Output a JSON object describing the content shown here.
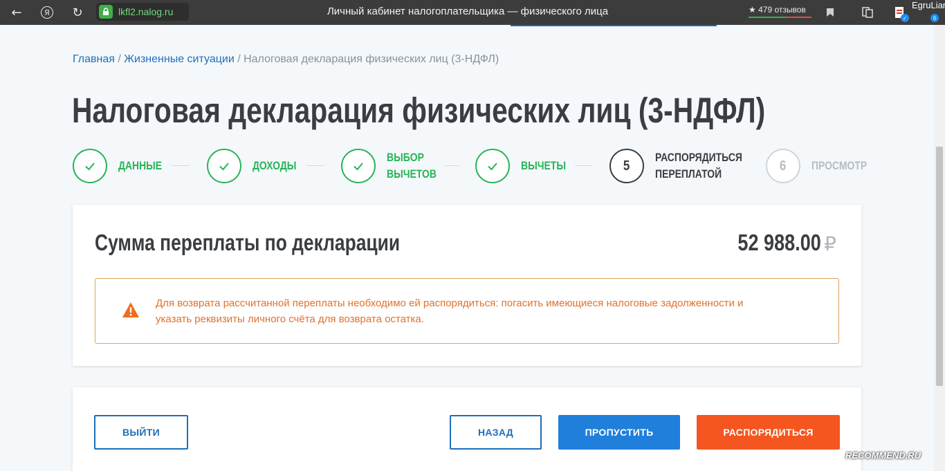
{
  "browser": {
    "url": "lkfl2.nalog.ru",
    "title": "Личный кабинет налогоплательщика — физического лица",
    "reviews": "479 отзывов",
    "reviews_star": "★",
    "user": "EgruLian",
    "badge_count": "6",
    "back_glyph": "←",
    "yandex_glyph": "Я",
    "reload_glyph": "↻"
  },
  "breadcrumb": {
    "home": "Главная",
    "sep1": " / ",
    "situations": "Жизненные ситуации",
    "sep2": " / ",
    "current": "Налоговая декларация физических лиц (3-НДФЛ)"
  },
  "page": {
    "title": "Налоговая декларация физических лиц (3-НДФЛ)"
  },
  "steps": [
    {
      "label_line1": "ДАННЫЕ",
      "label_line2": "",
      "state": "done",
      "num": ""
    },
    {
      "label_line1": "ДОХОДЫ",
      "label_line2": "",
      "state": "done",
      "num": ""
    },
    {
      "label_line1": "ВЫБОР",
      "label_line2": "ВЫЧЕТОВ",
      "state": "done",
      "num": ""
    },
    {
      "label_line1": "ВЫЧЕТЫ",
      "label_line2": "",
      "state": "done",
      "num": ""
    },
    {
      "label_line1": "РАСПОРЯДИТЬСЯ",
      "label_line2": "ПЕРЕПЛАТОЙ",
      "state": "current",
      "num": "5"
    },
    {
      "label_line1": "ПРОСМОТР",
      "label_line2": "",
      "state": "pending",
      "num": "6"
    }
  ],
  "overpayment": {
    "label": "Сумма переплаты по декларации",
    "amount": "52 988.00",
    "currency": "₽"
  },
  "alert": {
    "line1": "Для возврата рассчитанной переплаты необходимо ей распорядиться: погасить имеющиеся налоговые задолженности и",
    "line2": "указать реквизиты личного счёта для возврата остатка."
  },
  "actions": {
    "exit": "ВЫЙТИ",
    "back": "НАЗАД",
    "skip": "ПРОПУСТИТЬ",
    "dispose": "РАСПОРЯДИТЬСЯ"
  },
  "watermark": "RECOMMEND.RU",
  "colors": {
    "accent_green": "#27b356",
    "primary_blue": "#1e6fb8",
    "orange": "#f5561f",
    "alert_text": "#e0712c"
  }
}
